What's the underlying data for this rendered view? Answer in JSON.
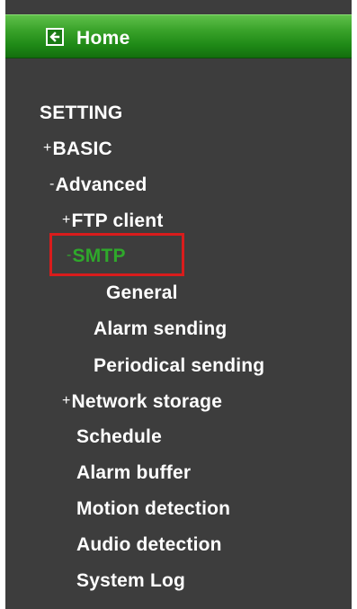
{
  "home": {
    "label": "Home",
    "icon": "back-arrow-icon"
  },
  "menu": {
    "section_title": "SETTING",
    "basic": {
      "prefix": "+",
      "label": "BASIC"
    },
    "advanced": {
      "prefix": "-",
      "label": "Advanced"
    },
    "ftp_client": {
      "prefix": "+",
      "label": "FTP client"
    },
    "smtp": {
      "prefix": "-",
      "label": "SMTP"
    },
    "smtp_children": [
      "General",
      "Alarm sending",
      "Periodical sending"
    ],
    "network_storage": {
      "prefix": "+",
      "label": "Network storage"
    },
    "schedule": {
      "label": "Schedule"
    },
    "alarm_buffer": {
      "label": "Alarm buffer"
    },
    "motion_detection": {
      "label": "Motion detection"
    },
    "audio_detection": {
      "label": "Audio detection"
    },
    "system_log": {
      "label": "System Log"
    }
  },
  "colors": {
    "sidebar_bg": "#3d3d3d",
    "home_bar": "#1f8a17",
    "active_item": "#2fa82b",
    "highlight_border": "#d91c1c",
    "text": "#ffffff"
  }
}
